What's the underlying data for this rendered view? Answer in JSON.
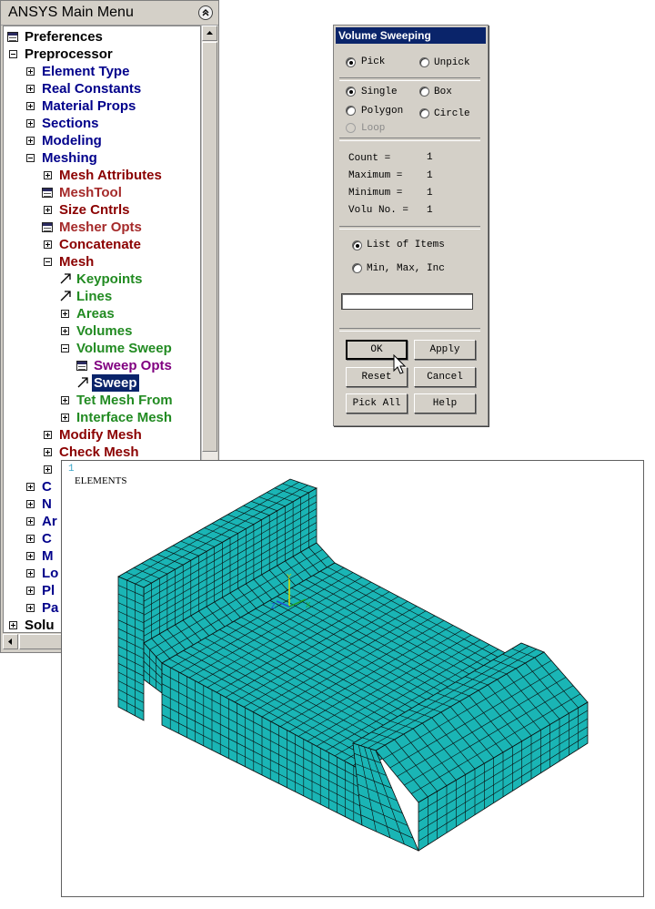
{
  "menu": {
    "title": "ANSYS Main Menu",
    "items": [
      {
        "label": "Preferences",
        "color": "black",
        "icon": "window-icon"
      },
      {
        "label": "Preprocessor",
        "color": "black",
        "icon": "collapse-icon"
      },
      {
        "label": "Element Type",
        "color": "navy",
        "icon": "expand-icon"
      },
      {
        "label": "Real Constants",
        "color": "navy",
        "icon": "expand-icon"
      },
      {
        "label": "Material Props",
        "color": "navy",
        "icon": "expand-icon"
      },
      {
        "label": "Sections",
        "color": "navy",
        "icon": "expand-icon"
      },
      {
        "label": "Modeling",
        "color": "navy",
        "icon": "expand-icon"
      },
      {
        "label": "Meshing",
        "color": "navy",
        "icon": "collapse-icon"
      },
      {
        "label": "Mesh Attributes",
        "color": "maroon",
        "icon": "expand-icon"
      },
      {
        "label": "MeshTool",
        "color": "brown",
        "icon": "window-icon"
      },
      {
        "label": "Size Cntrls",
        "color": "maroon",
        "icon": "expand-icon"
      },
      {
        "label": "Mesher Opts",
        "color": "brown",
        "icon": "window-icon"
      },
      {
        "label": "Concatenate",
        "color": "maroon",
        "icon": "expand-icon"
      },
      {
        "label": "Mesh",
        "color": "maroon",
        "icon": "collapse-icon"
      },
      {
        "label": "Keypoints",
        "color": "green",
        "icon": "pick-arrow-icon"
      },
      {
        "label": "Lines",
        "color": "green",
        "icon": "pick-arrow-icon"
      },
      {
        "label": "Areas",
        "color": "green",
        "icon": "expand-icon"
      },
      {
        "label": "Volumes",
        "color": "green",
        "icon": "expand-icon"
      },
      {
        "label": "Volume Sweep",
        "color": "green",
        "icon": "collapse-icon"
      },
      {
        "label": "Sweep Opts",
        "color": "purple",
        "icon": "window-icon"
      },
      {
        "label": "Sweep",
        "color": "purple",
        "icon": "pick-arrow-icon",
        "selected": true
      },
      {
        "label": "Tet Mesh From",
        "color": "green",
        "icon": "expand-icon"
      },
      {
        "label": "Interface Mesh",
        "color": "green",
        "icon": "expand-icon"
      },
      {
        "label": "Modify Mesh",
        "color": "maroon",
        "icon": "expand-icon"
      },
      {
        "label": "Check Mesh",
        "color": "maroon",
        "icon": "expand-icon"
      },
      {
        "label": "",
        "color": "maroon",
        "icon": "expand-icon"
      },
      {
        "label": "C",
        "color": "navy",
        "icon": "expand-icon"
      },
      {
        "label": "N",
        "color": "navy",
        "icon": "expand-icon"
      },
      {
        "label": "Ar",
        "color": "navy",
        "icon": "expand-icon"
      },
      {
        "label": "C",
        "color": "navy",
        "icon": "expand-icon"
      },
      {
        "label": "M",
        "color": "navy",
        "icon": "expand-icon"
      },
      {
        "label": "Lo",
        "color": "navy",
        "icon": "expand-icon"
      },
      {
        "label": "Pl",
        "color": "navy",
        "icon": "expand-icon"
      },
      {
        "label": "Pa",
        "color": "navy",
        "icon": "expand-icon"
      },
      {
        "label": "Solu",
        "color": "black",
        "icon": "expand-icon"
      }
    ]
  },
  "dialog": {
    "title": "Volume Sweeping",
    "pick": "Pick",
    "unpick": "Unpick",
    "single": "Single",
    "box": "Box",
    "polygon": "Polygon",
    "circle": "Circle",
    "loop": "Loop",
    "count_label": "Count    =",
    "count_value": "1",
    "maximum_label": "Maximum  =",
    "maximum_value": "1",
    "minimum_label": "Minimum  =",
    "minimum_value": "1",
    "volu_label": "Volu No. =",
    "volu_value": "1",
    "list_of_items": "List of Items",
    "min_max_inc": "Min, Max, Inc",
    "pick_field_value": "",
    "ok": "OK",
    "apply": "Apply",
    "reset": "Reset",
    "cancel": "Cancel",
    "pick_all": "Pick All",
    "help": "Help"
  },
  "graphics": {
    "window_number": "1",
    "label": "ELEMENTS",
    "axis_y": "Y",
    "axis_x": "X",
    "axis_z": "Z",
    "mesh_color": "#1ab5b5",
    "line_color": "#0a0a0a"
  },
  "colors": {
    "black": "#000000",
    "navy": "#00008b",
    "maroon": "#8b0000",
    "green": "#228b22",
    "purple": "#800080",
    "brown": "#a52a2a"
  }
}
